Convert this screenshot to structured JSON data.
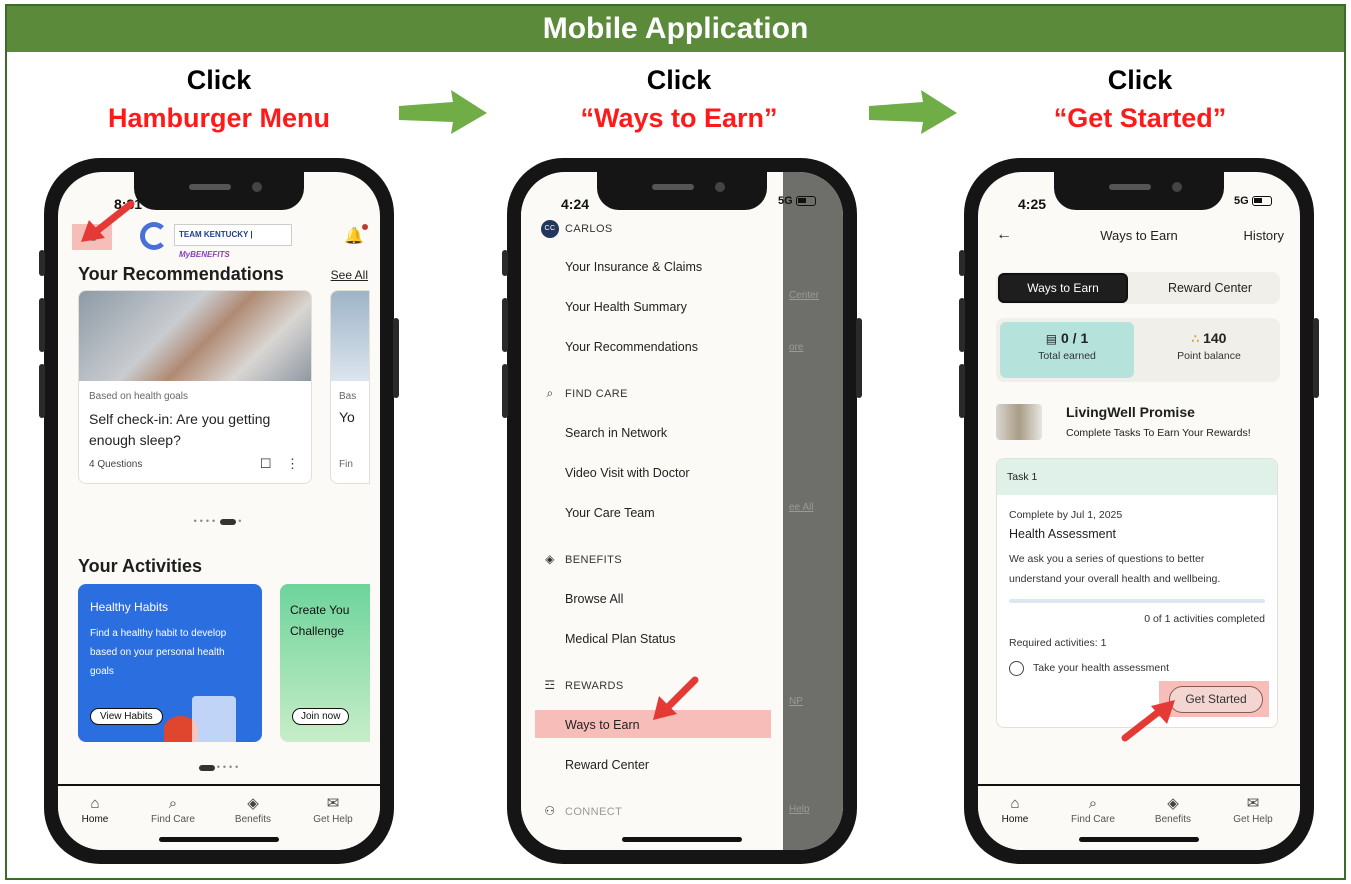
{
  "banner": {
    "title": "Mobile Application"
  },
  "steps": [
    {
      "click": "Click",
      "target": "Hamburger Menu"
    },
    {
      "click": "Click",
      "target": "“Ways to Earn”"
    },
    {
      "click": "Click",
      "target": "“Get Started”"
    }
  ],
  "colors": {
    "banner_bg": "#5b8a3a",
    "highlight": "#f6bdb9",
    "instruction_red": "#ff1a1a",
    "arrow_green": "#70ad47"
  },
  "tabbar": [
    {
      "label": "Home",
      "icon": "home-icon",
      "glyph": "⌂"
    },
    {
      "label": "Find Care",
      "icon": "search-icon",
      "glyph": "⌕"
    },
    {
      "label": "Benefits",
      "icon": "shield-icon",
      "glyph": "◈"
    },
    {
      "label": "Get Help",
      "icon": "chat-icon",
      "glyph": "✉"
    }
  ],
  "phone1": {
    "time": "8:31",
    "menu_glyph": "≡",
    "logo_team": "TEAM KENTUCKY",
    "logo_benefits": "MyBENEFITS",
    "recommendations": {
      "title": "Your Recommendations",
      "see_all": "See All",
      "card": {
        "tag": "Based on health goals",
        "title": "Self check-in: Are you getting enough sleep?",
        "meta": "4 Questions",
        "bookmark_glyph": "☐",
        "more_glyph": "⋮"
      },
      "peek": {
        "tag": "Bas",
        "title": "Yo",
        "meta": "Fin"
      }
    },
    "rec_dots": "••••",
    "rec_dots_after": "•",
    "activities": {
      "title": "Your Activities",
      "card1": {
        "title": "Healthy Habits",
        "desc": "Find a healthy habit to develop based on your personal health goals",
        "button": "View Habits"
      },
      "card2": {
        "title": "Create You Challenge",
        "button": "Join now"
      }
    },
    "act_dots": "••••"
  },
  "phone2": {
    "time": "4:24",
    "network": "5G",
    "user_initials": "CC",
    "user_name": "CARLOS",
    "items_account": [
      "Your Insurance & Claims",
      "Your Health Summary",
      "Your Recommendations"
    ],
    "find_care": {
      "label": "FIND CARE",
      "glyph": "⌕",
      "items": [
        "Search in Network",
        "Video Visit with Doctor",
        "Your Care Team"
      ]
    },
    "benefits": {
      "label": "BENEFITS",
      "glyph": "◈",
      "items": [
        "Browse All",
        "Medical Plan Status"
      ]
    },
    "rewards": {
      "label": "REWARDS",
      "glyph": "☲",
      "items": [
        "Ways to Earn",
        "Reward Center"
      ]
    },
    "connect": {
      "label": "CONNECT",
      "glyph": "⚇"
    },
    "ghosts": [
      "Center",
      "ore",
      "ee All",
      "NP",
      "Help"
    ]
  },
  "phone3": {
    "time": "4:25",
    "network": "5G",
    "back_glyph": "←",
    "title": "Ways to Earn",
    "history": "History",
    "tabs": [
      "Ways to Earn",
      "Reward Center"
    ],
    "stats": [
      {
        "value": "0 / 1",
        "label": "Total earned",
        "icon": "▤"
      },
      {
        "value": "140",
        "label": "Point balance",
        "icon": "∴"
      }
    ],
    "program": {
      "title": "LivingWell Promise",
      "subtitle": "Complete Tasks To Earn Your Rewards!"
    },
    "task": {
      "header": "Task 1",
      "due": "Complete by Jul 1, 2025",
      "name": "Health Assessment",
      "desc": "We ask you a series of questions to better understand your overall health and wellbeing.",
      "progress_fraction": 0,
      "progress_text": "0 of 1 activities completed",
      "required": "Required activities: 1",
      "activity": "Take your health assessment",
      "button": "Get Started"
    }
  }
}
